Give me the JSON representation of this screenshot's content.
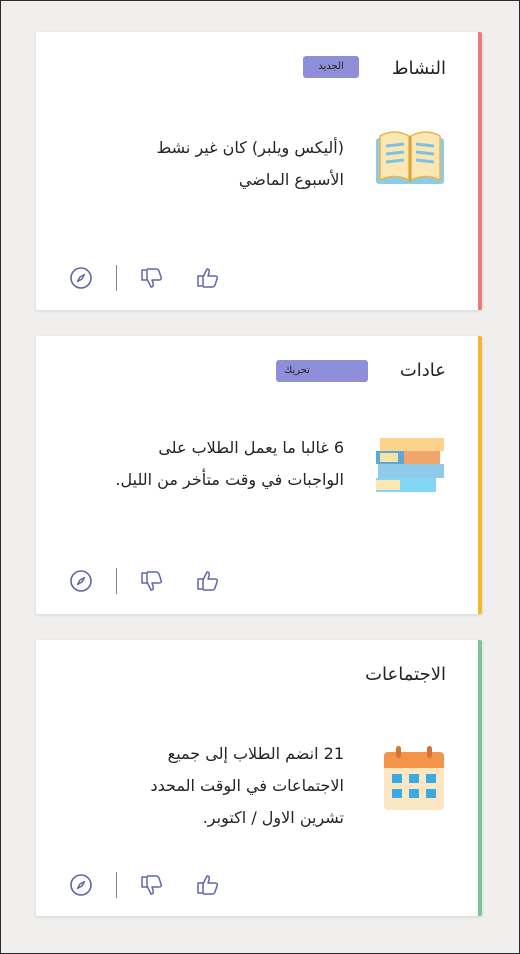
{
  "cards": [
    {
      "title": "النشاط",
      "badge": "الجديد",
      "body_lines": [
        "(أليكس ويلبر) كان غير نشط",
        "الأسبوع الماضي"
      ],
      "accent": "#e97c7a",
      "icon": "book-icon"
    },
    {
      "title": "عادات",
      "badge": "تحريك",
      "body_lines": [
        "6 غالبا ما يعمل الطلاب على",
        "الواجبات في وقت متأخر من الليل."
      ],
      "accent": "#f4b731",
      "icon": "books-stack-icon"
    },
    {
      "title": "الاجتماعات",
      "badge": "",
      "body_lines": [
        "21 انضم الطلاب إلى جميع",
        "الاجتماعات في الوقت المحدد",
        "تشرين الاول / اكتوبر."
      ],
      "accent": "#7bc58e",
      "icon": "calendar-icon"
    }
  ],
  "colors": {
    "badge_bg": "#8f8fd9",
    "action_icon": "#6264a7"
  }
}
